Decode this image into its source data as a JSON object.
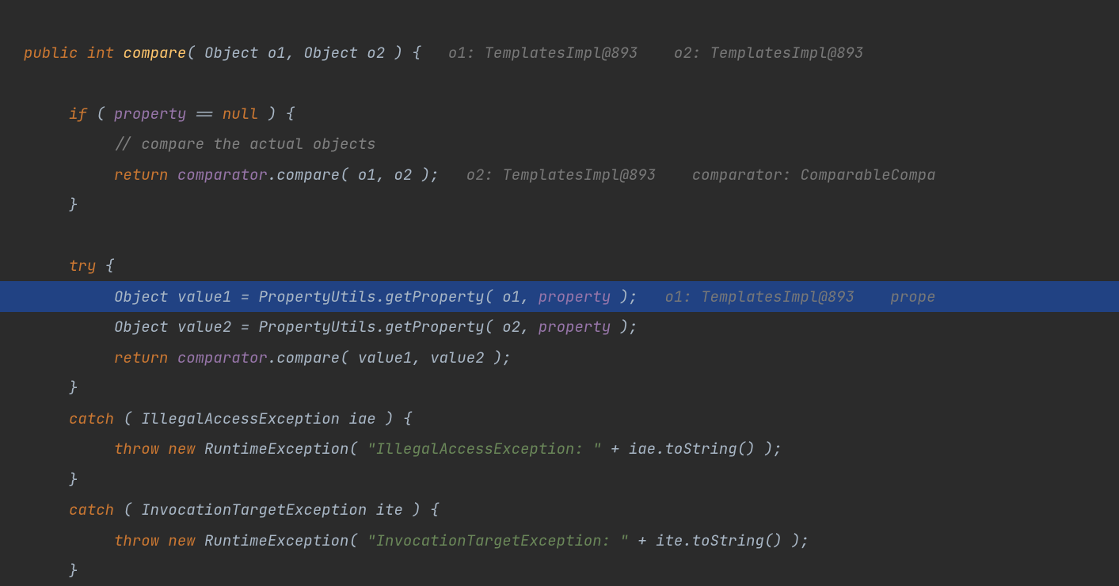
{
  "code": {
    "lines": [
      {
        "indent": 0,
        "segments": [
          {
            "cls": "kw",
            "t": "public "
          },
          {
            "cls": "kw",
            "t": "int "
          },
          {
            "cls": "method",
            "t": "compare"
          },
          {
            "cls": "punc",
            "t": "( "
          },
          {
            "cls": "type",
            "t": "Object "
          },
          {
            "cls": "param",
            "t": "o1"
          },
          {
            "cls": "punc",
            "t": ", "
          },
          {
            "cls": "type",
            "t": "Object "
          },
          {
            "cls": "param",
            "t": "o2"
          },
          {
            "cls": "punc",
            "t": " ) {   "
          },
          {
            "cls": "hint",
            "t": "o1: TemplatesImpl@893    o2: TemplatesImpl@893"
          }
        ]
      },
      {
        "indent": 0,
        "segments": []
      },
      {
        "indent": 1,
        "segments": [
          {
            "cls": "kw",
            "t": "if "
          },
          {
            "cls": "punc",
            "t": "( "
          },
          {
            "cls": "field",
            "t": "property"
          },
          {
            "cls": "op",
            "t": " == "
          },
          {
            "cls": "kw",
            "t": "null"
          },
          {
            "cls": "punc",
            "t": " ) {"
          }
        ]
      },
      {
        "indent": 2,
        "segments": [
          {
            "cls": "comment",
            "t": "// compare the actual objects"
          }
        ]
      },
      {
        "indent": 2,
        "segments": [
          {
            "cls": "kw",
            "t": "return "
          },
          {
            "cls": "field",
            "t": "comparator"
          },
          {
            "cls": "punc",
            "t": "."
          },
          {
            "cls": "ident",
            "t": "compare"
          },
          {
            "cls": "punc",
            "t": "( "
          },
          {
            "cls": "param",
            "t": "o1"
          },
          {
            "cls": "punc",
            "t": ", "
          },
          {
            "cls": "param",
            "t": "o2"
          },
          {
            "cls": "punc",
            "t": " );   "
          },
          {
            "cls": "hint",
            "t": "o2: TemplatesImpl@893    comparator: ComparableCompa"
          }
        ]
      },
      {
        "indent": 1,
        "segments": [
          {
            "cls": "punc",
            "t": "}"
          }
        ]
      },
      {
        "indent": 0,
        "segments": []
      },
      {
        "indent": 1,
        "segments": [
          {
            "cls": "kw",
            "t": "try "
          },
          {
            "cls": "punc",
            "t": "{"
          }
        ]
      },
      {
        "indent": 2,
        "highlighted": true,
        "segments": [
          {
            "cls": "type",
            "t": "Object "
          },
          {
            "cls": "ident",
            "t": "value1"
          },
          {
            "cls": "op",
            "t": " = "
          },
          {
            "cls": "type",
            "t": "PropertyUtils"
          },
          {
            "cls": "punc",
            "t": "."
          },
          {
            "cls": "italic-method",
            "t": "getProperty"
          },
          {
            "cls": "punc",
            "t": "( "
          },
          {
            "cls": "param",
            "t": "o1"
          },
          {
            "cls": "punc",
            "t": ", "
          },
          {
            "cls": "field",
            "t": "property"
          },
          {
            "cls": "punc",
            "t": " );   "
          },
          {
            "cls": "hint",
            "t": "o1: TemplatesImpl@893    prope"
          }
        ]
      },
      {
        "indent": 2,
        "segments": [
          {
            "cls": "type",
            "t": "Object "
          },
          {
            "cls": "ident",
            "t": "value2"
          },
          {
            "cls": "op",
            "t": " = "
          },
          {
            "cls": "type",
            "t": "PropertyUtils"
          },
          {
            "cls": "punc",
            "t": "."
          },
          {
            "cls": "italic-method",
            "t": "getProperty"
          },
          {
            "cls": "punc",
            "t": "( "
          },
          {
            "cls": "param",
            "t": "o2"
          },
          {
            "cls": "punc",
            "t": ", "
          },
          {
            "cls": "field",
            "t": "property"
          },
          {
            "cls": "punc",
            "t": " );"
          }
        ]
      },
      {
        "indent": 2,
        "segments": [
          {
            "cls": "kw",
            "t": "return "
          },
          {
            "cls": "field",
            "t": "comparator"
          },
          {
            "cls": "punc",
            "t": "."
          },
          {
            "cls": "ident",
            "t": "compare"
          },
          {
            "cls": "punc",
            "t": "( "
          },
          {
            "cls": "ident",
            "t": "value1"
          },
          {
            "cls": "punc",
            "t": ", "
          },
          {
            "cls": "ident",
            "t": "value2"
          },
          {
            "cls": "punc",
            "t": " );"
          }
        ]
      },
      {
        "indent": 1,
        "segments": [
          {
            "cls": "punc",
            "t": "}"
          }
        ]
      },
      {
        "indent": 1,
        "segments": [
          {
            "cls": "kw",
            "t": "catch "
          },
          {
            "cls": "punc",
            "t": "( "
          },
          {
            "cls": "type",
            "t": "IllegalAccessException "
          },
          {
            "cls": "ident",
            "t": "iae"
          },
          {
            "cls": "punc",
            "t": " ) {"
          }
        ]
      },
      {
        "indent": 2,
        "segments": [
          {
            "cls": "kw",
            "t": "throw "
          },
          {
            "cls": "kw",
            "t": "new "
          },
          {
            "cls": "type",
            "t": "RuntimeException"
          },
          {
            "cls": "punc",
            "t": "( "
          },
          {
            "cls": "str",
            "t": "\"IllegalAccessException: \""
          },
          {
            "cls": "op",
            "t": " + "
          },
          {
            "cls": "ident",
            "t": "iae"
          },
          {
            "cls": "punc",
            "t": "."
          },
          {
            "cls": "ident",
            "t": "toString"
          },
          {
            "cls": "punc",
            "t": "() );"
          }
        ]
      },
      {
        "indent": 1,
        "segments": [
          {
            "cls": "punc",
            "t": "}"
          }
        ]
      },
      {
        "indent": 1,
        "segments": [
          {
            "cls": "kw",
            "t": "catch "
          },
          {
            "cls": "punc",
            "t": "( "
          },
          {
            "cls": "type",
            "t": "InvocationTargetException "
          },
          {
            "cls": "ident",
            "t": "ite"
          },
          {
            "cls": "punc",
            "t": " ) {"
          }
        ]
      },
      {
        "indent": 2,
        "segments": [
          {
            "cls": "kw",
            "t": "throw "
          },
          {
            "cls": "kw",
            "t": "new "
          },
          {
            "cls": "type",
            "t": "RuntimeException"
          },
          {
            "cls": "punc",
            "t": "( "
          },
          {
            "cls": "str",
            "t": "\"InvocationTargetException: \""
          },
          {
            "cls": "op",
            "t": " + "
          },
          {
            "cls": "ident",
            "t": "ite"
          },
          {
            "cls": "punc",
            "t": "."
          },
          {
            "cls": "ident",
            "t": "toString"
          },
          {
            "cls": "punc",
            "t": "() );"
          }
        ]
      },
      {
        "indent": 1,
        "segments": [
          {
            "cls": "punc",
            "t": "}"
          }
        ]
      }
    ]
  }
}
